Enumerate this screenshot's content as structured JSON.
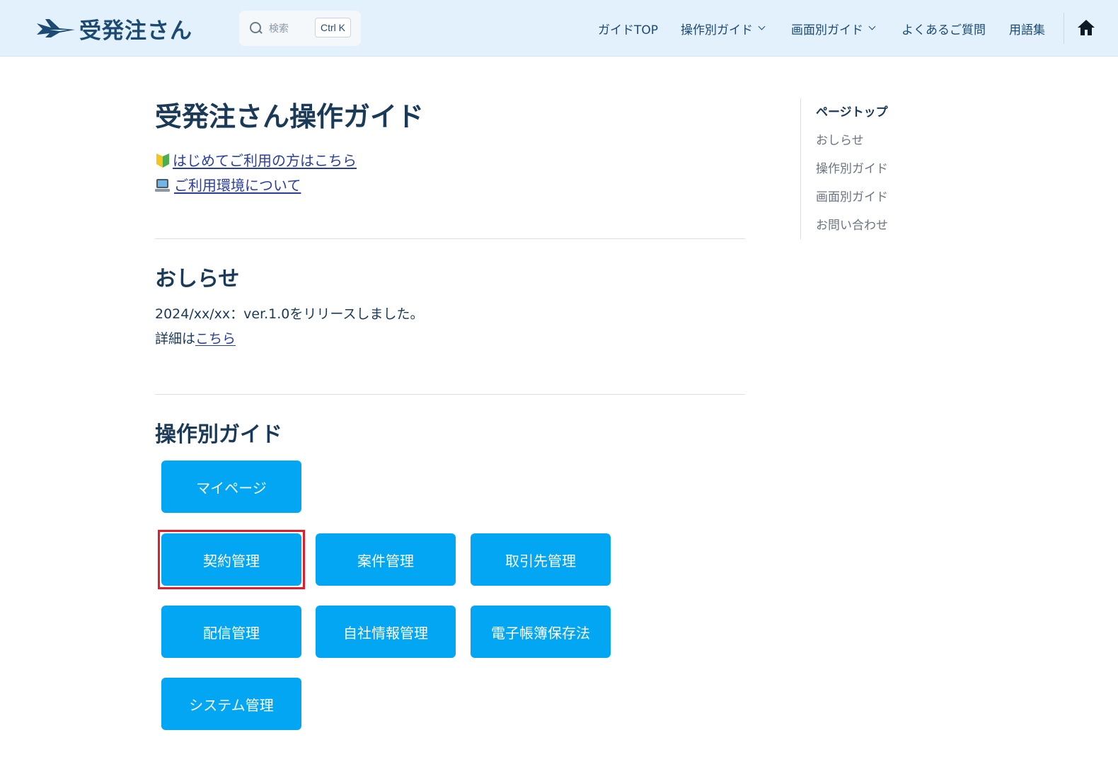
{
  "header": {
    "logo_text": "受発注さん",
    "search": {
      "placeholder": "検索",
      "shortcut": "Ctrl K"
    },
    "nav": [
      {
        "label": "ガイドTOP",
        "dropdown": false
      },
      {
        "label": "操作別ガイド",
        "dropdown": true
      },
      {
        "label": "画面別ガイド",
        "dropdown": true
      },
      {
        "label": "よくあるご質問",
        "dropdown": false
      },
      {
        "label": "用語集",
        "dropdown": false
      }
    ]
  },
  "main": {
    "title": "受発注さん操作ガイド",
    "links": [
      {
        "icon": "beginner-mark-icon",
        "label": "はじめてご利用の方はこちら"
      },
      {
        "icon": "laptop-icon",
        "label": "ご利用環境について"
      }
    ],
    "notice": {
      "title": "おしらせ",
      "line1": "2024/xx/xx：ver.1.0をリリースしました。",
      "line2_prefix": "詳細は",
      "line2_link": "こちら"
    },
    "guides": {
      "title": "操作別ガイド",
      "buttons": [
        "マイページ",
        "契約管理",
        "案件管理",
        "取引先管理",
        "配信管理",
        "自社情報管理",
        "電子帳簿保存法",
        "システム管理"
      ]
    }
  },
  "toc": [
    "ページトップ",
    "おしらせ",
    "操作別ガイド",
    "画面別ガイド",
    "お問い合わせ"
  ],
  "colors": {
    "accent": "#02a6f2",
    "header_bg": "#e3f1fc",
    "highlight": "#e41c2b",
    "link": "#2a3ea0"
  }
}
